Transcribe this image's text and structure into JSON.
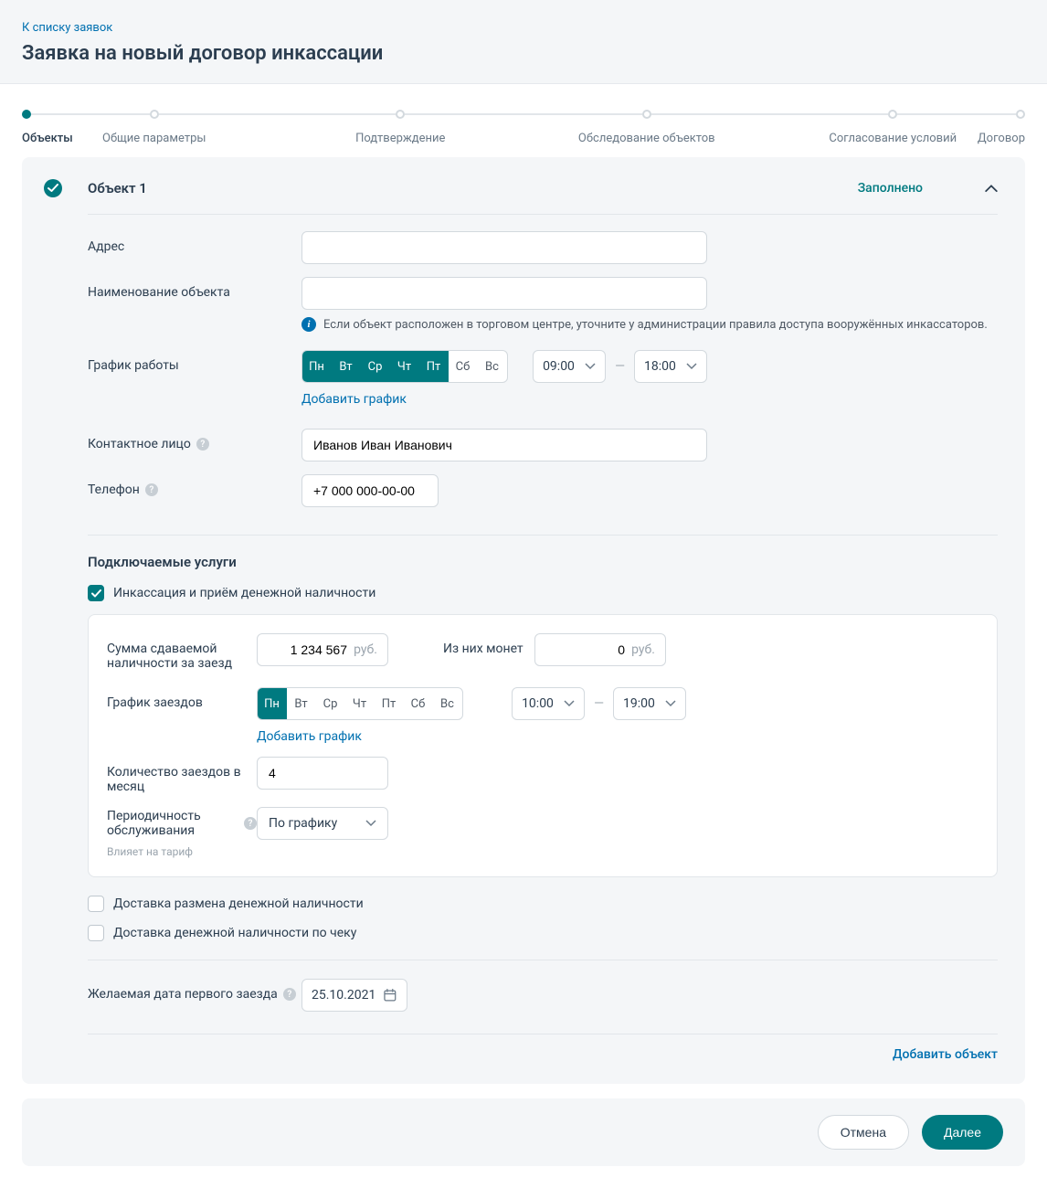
{
  "header": {
    "back_link": "К списку заявок",
    "title": "Заявка на новый договор инкассации"
  },
  "stepper": {
    "steps": [
      "Объекты",
      "Общие параметры",
      "Подтверждение",
      "Обследование объектов",
      "Согласование условий",
      "Договор"
    ],
    "active_index": 0
  },
  "object_card": {
    "title": "Объект 1",
    "status": "Заполнено",
    "labels": {
      "address": "Адрес",
      "name": "Наименование объекта",
      "schedule": "График работы",
      "contact": "Контактное лицо",
      "phone": "Телефон"
    },
    "values": {
      "address": "",
      "name": "",
      "contact": "Иванов Иван Иванович",
      "phone": "+7 000 000-00-00"
    },
    "info_note": "Если объект расположен в торговом центре, уточните у администрации правила доступа вооружённых инкассаторов.",
    "days": [
      "Пн",
      "Вт",
      "Ср",
      "Чт",
      "Пт",
      "Сб",
      "Вс"
    ],
    "days_active": [
      true,
      true,
      true,
      true,
      true,
      false,
      false
    ],
    "time_from": "09:00",
    "time_to": "18:00",
    "add_schedule": "Добавить график"
  },
  "services": {
    "section_title": "Подключаемые услуги",
    "items": [
      {
        "label": "Инкассация и приём денежной наличности",
        "checked": true
      },
      {
        "label": "Доставка размена денежной наличности",
        "checked": false
      },
      {
        "label": "Доставка денежной наличности по чеку",
        "checked": false
      }
    ]
  },
  "collection": {
    "labels": {
      "cash_sum": "Сумма сдаваемой наличности за заезд",
      "coins": "Из них монет",
      "visit_schedule": "График заездов",
      "visits_per_month": "Количество заездов в месяц",
      "periodicity": "Периодичность обслуживания",
      "periodicity_sub": "Влияет на тариф"
    },
    "values": {
      "cash_sum": "1 234 567",
      "coins": "0",
      "visits_per_month": "4",
      "periodicity": "По графику"
    },
    "currency_suffix": "руб.",
    "days": [
      "Пн",
      "Вт",
      "Ср",
      "Чт",
      "Пт",
      "Сб",
      "Вс"
    ],
    "days_active": [
      true,
      false,
      false,
      false,
      false,
      false,
      false
    ],
    "time_from": "10:00",
    "time_to": "19:00",
    "add_schedule": "Добавить график"
  },
  "first_visit": {
    "label": "Желаемая дата первого заезда",
    "value": "25.10.2021"
  },
  "actions": {
    "add_object": "Добавить объект",
    "cancel": "Отмена",
    "next": "Далее"
  }
}
